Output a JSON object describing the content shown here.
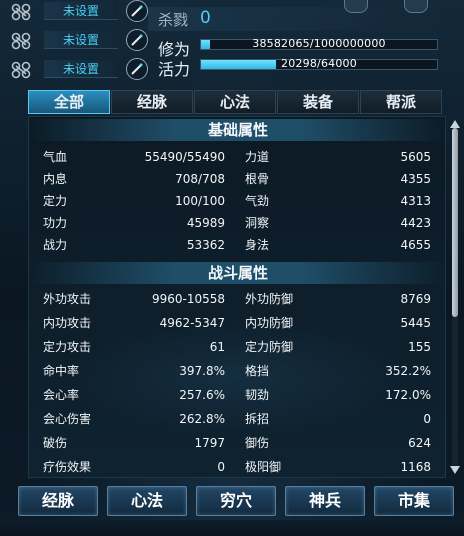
{
  "slots": [
    {
      "label": "未设置",
      "icon": "gear-link-icon",
      "edit_icon": "pencil-icon"
    },
    {
      "label": "未设置",
      "icon": "gear-link-icon",
      "edit_icon": "pencil-icon"
    },
    {
      "label": "未设置",
      "icon": "gear-link-icon",
      "edit_icon": "pencil-icon"
    }
  ],
  "kills": {
    "label": "杀戮",
    "value": "0"
  },
  "cultivation": {
    "label": "修为",
    "text": "38582065/1000000000",
    "fraction": 0.0386
  },
  "vitality": {
    "label": "活力",
    "text": "20298/64000",
    "fraction": 0.317
  },
  "tabs": [
    {
      "label": "全部",
      "active": true
    },
    {
      "label": "经脉",
      "active": false
    },
    {
      "label": "心法",
      "active": false
    },
    {
      "label": "装备",
      "active": false
    },
    {
      "label": "帮派",
      "active": false
    }
  ],
  "sections": {
    "basic": {
      "title": "基础属性",
      "left": [
        {
          "name": "气血",
          "value": "55490/55490"
        },
        {
          "name": "内息",
          "value": "708/708"
        },
        {
          "name": "定力",
          "value": "100/100"
        },
        {
          "name": "功力",
          "value": "45989"
        },
        {
          "name": "战力",
          "value": "53362"
        }
      ],
      "right": [
        {
          "name": "力道",
          "value": "5605"
        },
        {
          "name": "根骨",
          "value": "4355"
        },
        {
          "name": "气劲",
          "value": "4313"
        },
        {
          "name": "洞察",
          "value": "4423"
        },
        {
          "name": "身法",
          "value": "4655"
        }
      ]
    },
    "combat": {
      "title": "战斗属性",
      "left": [
        {
          "name": "外功攻击",
          "value": "9960-10558"
        },
        {
          "name": "内功攻击",
          "value": "4962-5347"
        },
        {
          "name": "定力攻击",
          "value": "61"
        },
        {
          "name": "命中率",
          "value": "397.8%"
        },
        {
          "name": "会心率",
          "value": "257.6%"
        },
        {
          "name": "会心伤害",
          "value": "262.8%"
        },
        {
          "name": "破伤",
          "value": "1797"
        },
        {
          "name": "疗伤效果",
          "value": "0"
        }
      ],
      "right": [
        {
          "name": "外功防御",
          "value": "8769"
        },
        {
          "name": "内功防御",
          "value": "5445"
        },
        {
          "name": "定力防御",
          "value": "155"
        },
        {
          "name": "格挡",
          "value": "352.2%"
        },
        {
          "name": "韧劲",
          "value": "172.0%"
        },
        {
          "name": "拆招",
          "value": "0"
        },
        {
          "name": "御伤",
          "value": "624"
        },
        {
          "name": "极阳御",
          "value": "1168"
        }
      ]
    }
  },
  "scroll": {
    "position": 0.0,
    "visible_fraction": 0.56
  },
  "bottom_buttons": [
    {
      "label": "经脉"
    },
    {
      "label": "心法"
    },
    {
      "label": "穷穴"
    },
    {
      "label": "神兵"
    },
    {
      "label": "市集"
    }
  ],
  "colors": {
    "accent": "#49d0f4",
    "tab_active": "#2a8fc0",
    "bar_fill": "#49d0f4"
  }
}
